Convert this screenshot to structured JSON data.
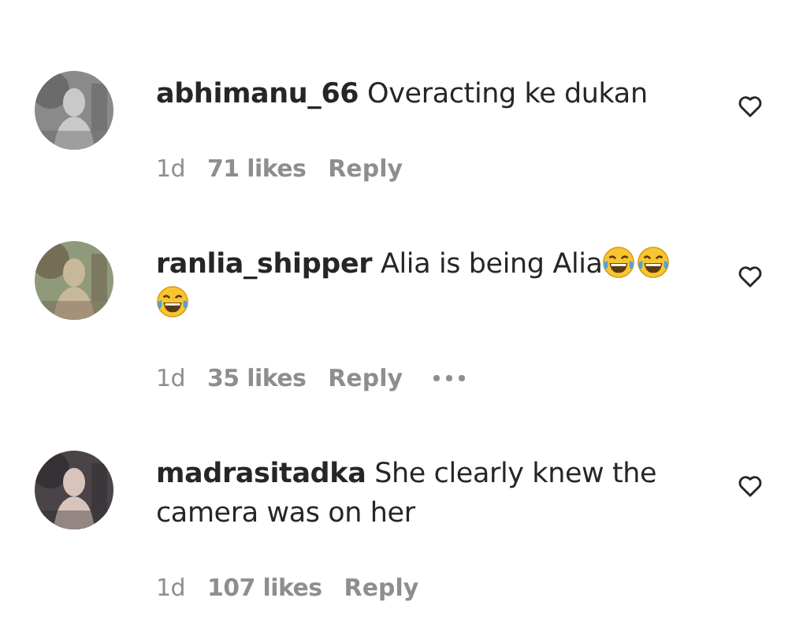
{
  "comments": [
    {
      "username": "abhimanu_66",
      "parts": [
        {
          "kind": "text",
          "text": "Overacting ke dukan"
        }
      ],
      "time": "1d",
      "likes": "71 likes",
      "reply": "Reply",
      "show_more": false,
      "liked": false
    },
    {
      "username": "ranlia_shipper",
      "parts": [
        {
          "kind": "text",
          "text": "Alia is being Alia"
        },
        {
          "kind": "emoji"
        },
        {
          "kind": "emoji"
        },
        {
          "kind": "emoji"
        }
      ],
      "time": "1d",
      "likes": "35 likes",
      "reply": "Reply",
      "show_more": true,
      "liked": false
    },
    {
      "username": "madrasitadka",
      "parts": [
        {
          "kind": "text",
          "text": "She clearly knew the camera was on her"
        }
      ],
      "time": "1d",
      "likes": "107 likes",
      "reply": "Reply",
      "show_more": false,
      "liked": false
    }
  ]
}
